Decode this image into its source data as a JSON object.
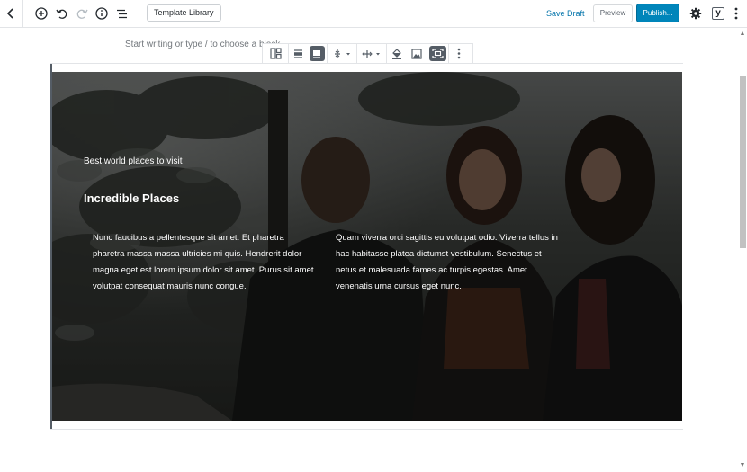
{
  "topbar": {
    "template_library": "Template Library",
    "save_draft": "Save Draft",
    "preview": "Preview",
    "publish": "Publish...",
    "yoast_letter": "y"
  },
  "editor": {
    "placeholder": "Start writing or type / to choose a block"
  },
  "cover": {
    "eyebrow": "Best world places to visit",
    "heading": "Incredible Places",
    "column_left": "Nunc faucibus a pellentesque sit amet. Et pharetra pharetra massa massa ultricies mi quis. Hendrerit dolor magna eget est lorem ipsum dolor sit amet. Purus sit amet volutpat consequat mauris nunc congue.",
    "column_right": "Quam viverra orci sagittis eu volutpat odio. Viverra tellus in hac habitasse platea dictumst vestibulum. Senectus et netus et malesuada fames ac turpis egestas. Amet venenatis urna cursus eget nunc."
  },
  "colors": {
    "accent": "#0085ba",
    "link": "#0073aa"
  }
}
